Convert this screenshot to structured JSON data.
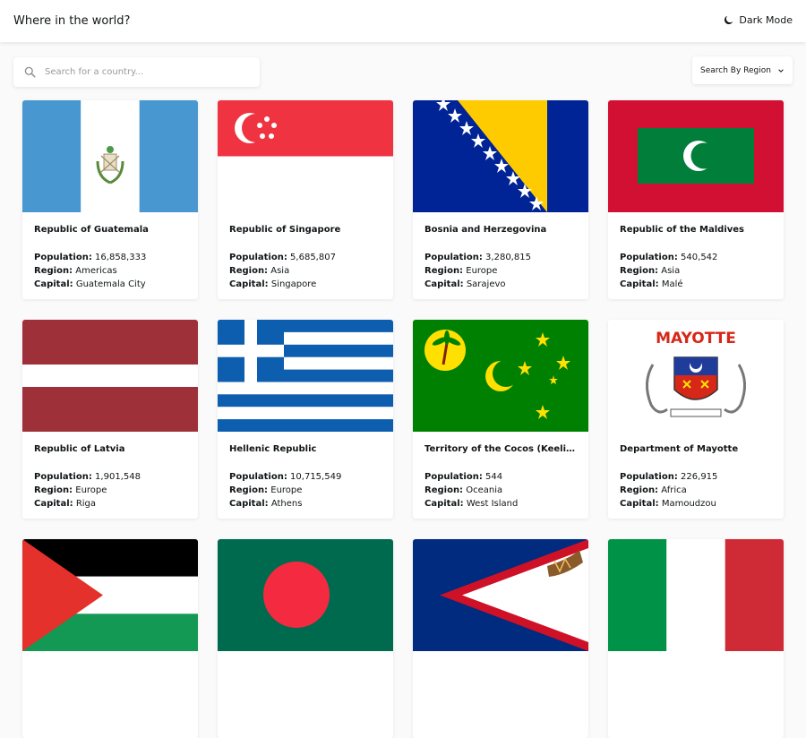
{
  "header": {
    "title": "Where in the world?",
    "theme_toggle_label": "Dark Mode"
  },
  "search": {
    "placeholder": "Search for a country...",
    "value": ""
  },
  "region_filter": {
    "label": "Search By Region"
  },
  "labels": {
    "population": "Population:",
    "region": "Region:",
    "capital": "Capital:"
  },
  "countries": [
    {
      "name": "Republic of Guatemala",
      "population": "16,858,333",
      "region": "Americas",
      "capital": "Guatemala City",
      "flag": "guatemala-flag"
    },
    {
      "name": "Republic of Singapore",
      "population": "5,685,807",
      "region": "Asia",
      "capital": "Singapore",
      "flag": "singapore-flag"
    },
    {
      "name": "Bosnia and Herzegovina",
      "population": "3,280,815",
      "region": "Europe",
      "capital": "Sarajevo",
      "flag": "bosnia-flag"
    },
    {
      "name": "Republic of the Maldives",
      "population": "540,542",
      "region": "Asia",
      "capital": "Malé",
      "flag": "maldives-flag"
    },
    {
      "name": "Republic of Latvia",
      "population": "1,901,548",
      "region": "Europe",
      "capital": "Riga",
      "flag": "latvia-flag"
    },
    {
      "name": "Hellenic Republic",
      "population": "10,715,549",
      "region": "Europe",
      "capital": "Athens",
      "flag": "greece-flag"
    },
    {
      "name": "Territory of the Cocos (Keeling) Islands",
      "population": "544",
      "region": "Oceania",
      "capital": "West Island",
      "flag": "cocos-islands-flag"
    },
    {
      "name": "Department of Mayotte",
      "population": "226,915",
      "region": "Africa",
      "capital": "Mamoudzou",
      "flag": "mayotte-flag",
      "flag_text": "MAYOTTE"
    },
    {
      "name": "",
      "population": "",
      "region": "",
      "capital": "",
      "flag": "palestine-flag"
    },
    {
      "name": "",
      "population": "",
      "region": "",
      "capital": "",
      "flag": "bangladesh-flag"
    },
    {
      "name": "",
      "population": "",
      "region": "",
      "capital": "",
      "flag": "american-samoa-flag"
    },
    {
      "name": "",
      "population": "",
      "region": "",
      "capital": "",
      "flag": "italy-flag"
    }
  ],
  "colors": {
    "background": "#fafafa",
    "card": "#ffffff",
    "text": "#111517"
  }
}
